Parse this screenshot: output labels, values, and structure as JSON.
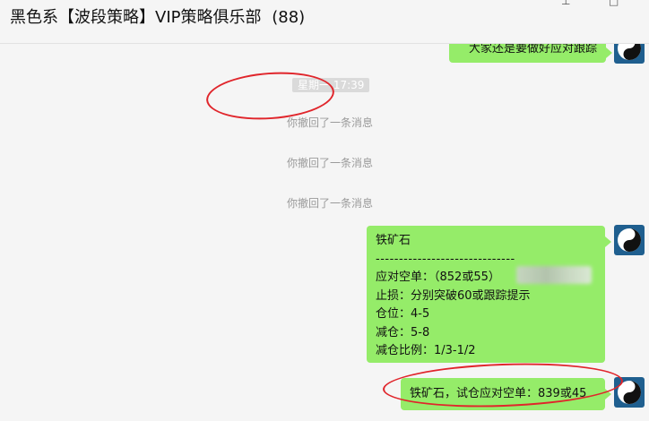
{
  "header": {
    "title": "黑色系【波段策略】VIP策略俱乐部",
    "member_count": "(88)"
  },
  "window_controls": {
    "pin_glyph": "⊥",
    "close_glyph": "□"
  },
  "messages": {
    "top_partial": "大家还是要做好应对跟踪",
    "time_chip": "星期一 17:39",
    "recall_notice": "你撤回了一条消息",
    "main": {
      "lines": [
        "铁矿石",
        "------------------------------",
        "应对空单：（852或55）",
        "止损：分别突破60或跟踪提示",
        "仓位：4-5",
        "减仓：5-8",
        "减仓比例：1/3-1/2"
      ]
    },
    "last": "铁矿石，试仓应对空单：839或45"
  },
  "colors": {
    "bubble": "#95ec69",
    "annotation": "#e0252b",
    "avatar": "#1f5f8f"
  },
  "icons": [
    "yin-yang-icon"
  ]
}
